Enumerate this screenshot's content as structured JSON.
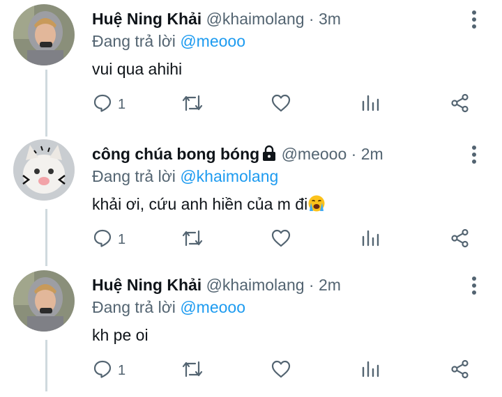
{
  "tweets": [
    {
      "name": "Huệ Ning Khải",
      "handle": "@khaimolang",
      "separator": " · ",
      "time": "3m",
      "replying_label": "Đang trả lời ",
      "replying_to": "@meooo",
      "text": "vui qua ahihi",
      "reply_count": "1",
      "avatar": "boy-hoodie-avatar"
    },
    {
      "name": "công chúa bong bóng",
      "handle": "@meooo",
      "separator": " · ",
      "time": "2m",
      "replying_label": "Đang trả lời ",
      "replying_to": "@khaimolang",
      "text": "khải ơi, cứu anh hiền của m đi",
      "emoji": "loudly-crying-face",
      "protected_icon": "lock-icon",
      "reply_count": "1",
      "avatar": "cat-avatar"
    },
    {
      "name": "Huệ Ning Khải",
      "handle": "@khaimolang",
      "separator": " · ",
      "time": "2m",
      "replying_label": "Đang trả lời ",
      "replying_to": "@meooo",
      "text": "kh pe oi",
      "reply_count": "1",
      "avatar": "boy-hoodie-avatar"
    }
  ],
  "icons": [
    "reply-icon",
    "retweet-icon",
    "like-icon",
    "analytics-icon",
    "share-icon",
    "more-options-icon"
  ],
  "colors": {
    "text": "#0f1419",
    "secondary": "#536471",
    "link": "#1d9bf0",
    "thread_line": "#cfd9de"
  }
}
